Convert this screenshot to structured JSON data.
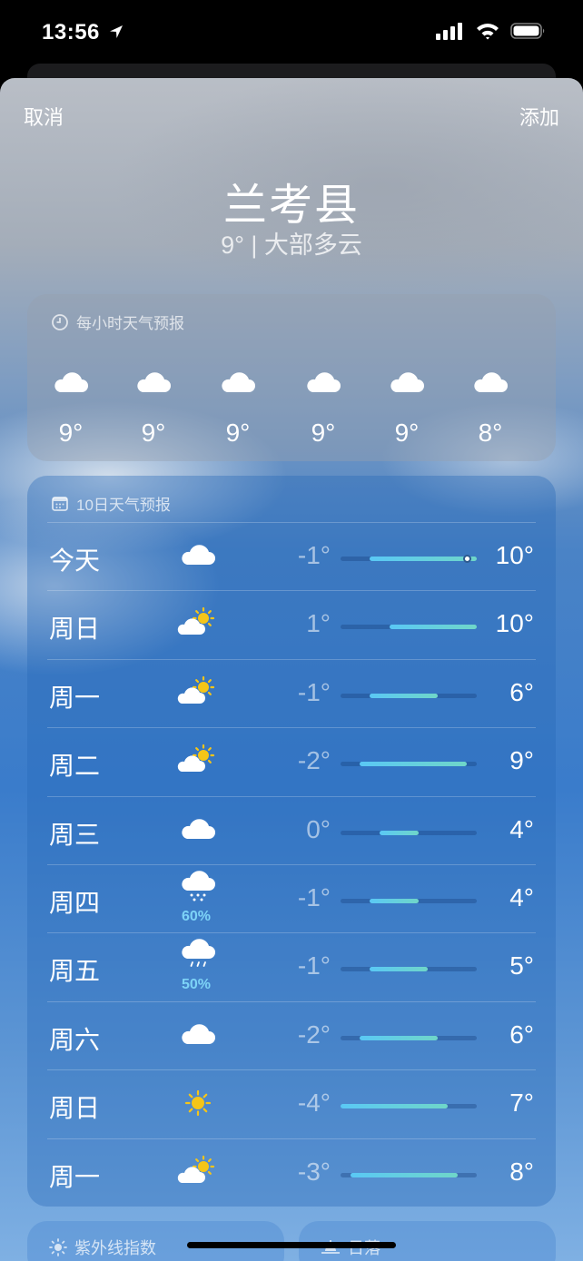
{
  "status": {
    "time": "13:56"
  },
  "nav": {
    "cancel": "取消",
    "add": "添加"
  },
  "location": {
    "name": "兰考县",
    "summary": "9° | 大部多云"
  },
  "hourly": {
    "title": "每小时天气预报",
    "items": [
      {
        "icon": "cloud-icon",
        "temp": "9°"
      },
      {
        "icon": "cloud-icon",
        "temp": "9°"
      },
      {
        "icon": "cloud-icon",
        "temp": "9°"
      },
      {
        "icon": "cloud-icon",
        "temp": "9°"
      },
      {
        "icon": "cloud-icon",
        "temp": "9°"
      },
      {
        "icon": "cloud-icon",
        "temp": "8°"
      }
    ]
  },
  "daily": {
    "title": "10日天气预报",
    "range": {
      "min": -4,
      "max": 10
    },
    "current_temp": 9,
    "days": [
      {
        "name": "今天",
        "icon": "cloud-icon",
        "precip": "",
        "low_label": "-1°",
        "high_label": "10°",
        "low": -1,
        "high": 10,
        "current": true
      },
      {
        "name": "周日",
        "icon": "partly-sunny-icon",
        "precip": "",
        "low_label": "1°",
        "high_label": "10°",
        "low": 1,
        "high": 10
      },
      {
        "name": "周一",
        "icon": "partly-sunny-icon",
        "precip": "",
        "low_label": "-1°",
        "high_label": "6°",
        "low": -1,
        "high": 6
      },
      {
        "name": "周二",
        "icon": "partly-sunny-icon",
        "precip": "",
        "low_label": "-2°",
        "high_label": "9°",
        "low": -2,
        "high": 9
      },
      {
        "name": "周三",
        "icon": "cloud-icon",
        "precip": "",
        "low_label": "0°",
        "high_label": "4°",
        "low": 0,
        "high": 4
      },
      {
        "name": "周四",
        "icon": "snow-cloud-icon",
        "precip": "60%",
        "low_label": "-1°",
        "high_label": "4°",
        "low": -1,
        "high": 4
      },
      {
        "name": "周五",
        "icon": "rain-cloud-icon",
        "precip": "50%",
        "low_label": "-1°",
        "high_label": "5°",
        "low": -1,
        "high": 5
      },
      {
        "name": "周六",
        "icon": "cloud-icon",
        "precip": "",
        "low_label": "-2°",
        "high_label": "6°",
        "low": -2,
        "high": 6
      },
      {
        "name": "周日",
        "icon": "sun-icon",
        "precip": "",
        "low_label": "-4°",
        "high_label": "7°",
        "low": -4,
        "high": 7
      },
      {
        "name": "周一",
        "icon": "partly-sunny-icon",
        "precip": "",
        "low_label": "-3°",
        "high_label": "8°",
        "low": -3,
        "high": 8
      }
    ]
  },
  "bottom_cards": {
    "uv_title": "紫外线指数",
    "sunset_title": "日落"
  },
  "colors": {
    "bar_start": "#5ac8f5",
    "bar_end": "#6fd6c9",
    "precip": "#7dd3f7",
    "sun": "#f5c518"
  }
}
